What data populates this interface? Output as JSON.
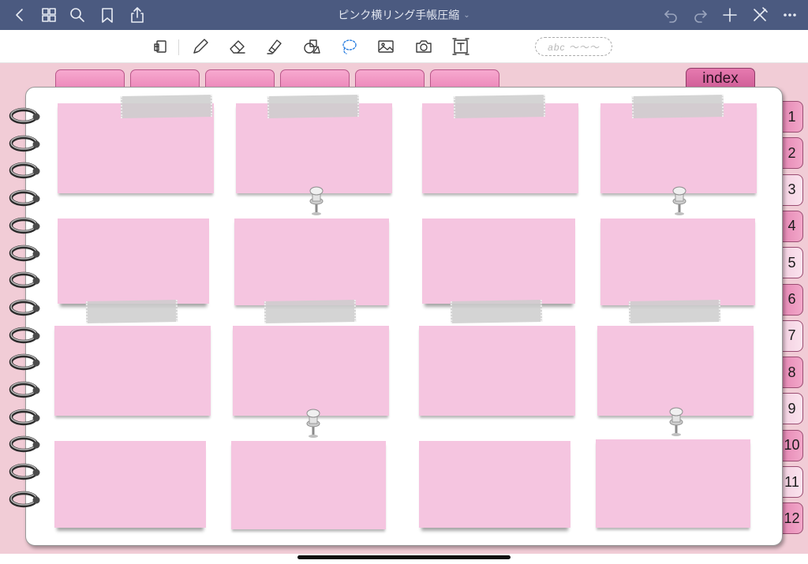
{
  "app": {
    "document_title": "ピンク横リング手帳圧縮",
    "title_chevron": "⌄"
  },
  "toolbar": {
    "pen_sample_text": "abc ～～～",
    "bluetooth_mark": "ᛒ"
  },
  "planner": {
    "top_tabs_count": 6,
    "index_tab_label": "index",
    "month_tabs": [
      {
        "label": "1",
        "style": "dark"
      },
      {
        "label": "2",
        "style": "dark"
      },
      {
        "label": "3",
        "style": "light"
      },
      {
        "label": "4",
        "style": "dark"
      },
      {
        "label": "5",
        "style": "light"
      },
      {
        "label": "6",
        "style": "dark"
      },
      {
        "label": "7",
        "style": "light"
      },
      {
        "label": "8",
        "style": "dark"
      },
      {
        "label": "9",
        "style": "light"
      },
      {
        "label": "10",
        "style": "dark"
      },
      {
        "label": "11",
        "style": "light"
      },
      {
        "label": "12",
        "style": "dark"
      }
    ],
    "ring_count": 15,
    "sticky_notes": {
      "rows": 4,
      "columns": 4,
      "note_color": "#f5c5e0",
      "tape_color": "#cdcdcd"
    }
  },
  "colors": {
    "nav_bar": "#4b5a80",
    "canvas_background": "#f1ccd6",
    "tab_pink": "#ea82b6",
    "index_tab": "#cc5a93"
  }
}
